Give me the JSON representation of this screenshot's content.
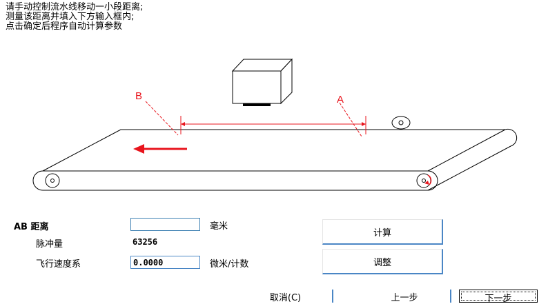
{
  "instructions": {
    "line1": "请手动控制流水线移动一小段距离;",
    "line2": "测量该距离并填入下方输入框内;",
    "line3": "点击确定后程序自动计算参数"
  },
  "diagram": {
    "label_a": "A",
    "label_b": "B",
    "arrow_color": "#e8141c"
  },
  "form": {
    "ab_label": "AB 距离",
    "ab_value": "",
    "ab_unit": "毫米",
    "pulse_label": "脉冲量",
    "pulse_value": "63256",
    "speed_label": "飞行速度系",
    "speed_value": "0.0000",
    "speed_unit": "微米/计数"
  },
  "buttons": {
    "calculate": "计算",
    "adjust": "调整",
    "cancel": "取消(C)",
    "previous": "上一步",
    "next": "下一步"
  }
}
